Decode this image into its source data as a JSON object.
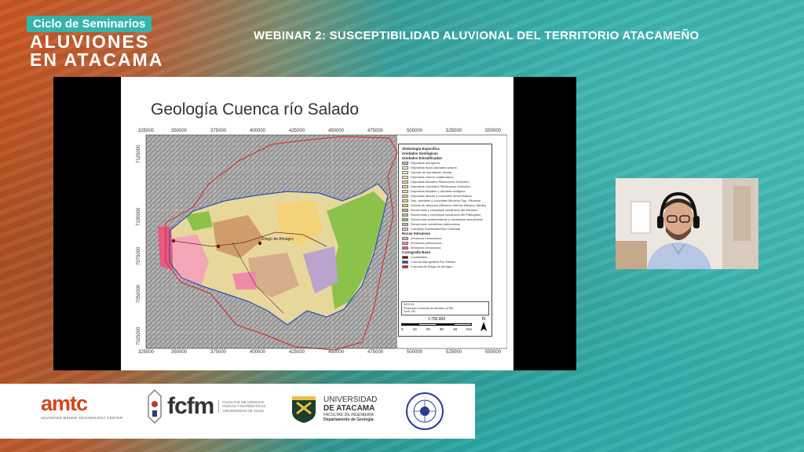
{
  "header": {
    "series_tag": "Ciclo de Seminarios",
    "event_title_line1": "ALUVIONES",
    "event_title_line2": "EN ATACAMA",
    "webinar_title": "WEBINAR 2: SUSCEPTIBILIDAD ALUVIONAL DEL TERRITORIO ATACAMEÑO"
  },
  "slide": {
    "title": "Geología Cuenca río Salado",
    "x_ticks": [
      "325000",
      "350000",
      "375000",
      "400000",
      "425000",
      "450000",
      "475000",
      "500000",
      "525000",
      "550000"
    ],
    "y_ticks": [
      "7125000",
      "7100000",
      "7075000",
      "7050000",
      "7025000"
    ],
    "map_labels": {
      "town": "Diego de Almagro"
    },
    "legend": {
      "title": "Simbología Específica",
      "section_units": "Unidades Geológicas",
      "section_strat": "Unidades Estratificadas",
      "items": [
        {
          "label": "Depósitos antrópicos",
          "color": "#b8b8b8"
        },
        {
          "label": "Depósitos fluvio-aluviales activos",
          "color": "#f4f0b8"
        },
        {
          "label": "Llanura de inundación aluvial",
          "color": "#fff59a"
        },
        {
          "label": "Depósitos eólicos cuaternarios",
          "color": "#f7e7a1"
        },
        {
          "label": "Depósitos aluviales Pleistoceno-Holoceno",
          "color": "#f4d27a"
        },
        {
          "label": "Depósitos coluviales Pleistoceno-Holoceno",
          "color": "#e8c99a"
        },
        {
          "label": "Depósitos fluviales y aluviales antiguos",
          "color": "#e6d6b0"
        },
        {
          "label": "Depósitos lávicos y coluviales derrumbados",
          "color": "#d9c7a0"
        },
        {
          "label": "Dep. aluviales y coluviales Mioceno Sup.-Plioceno",
          "color": "#e3cf7c"
        },
        {
          "label": "Gravas de Atacama (Mioceno Inferior-Mioceno Medio)",
          "color": "#e9b45d"
        },
        {
          "label": "Secuencias y complejos volcánicos del Mioceno",
          "color": "#cf9d6b"
        },
        {
          "label": "Secuencias y complejos volcánicos del Paleógeno",
          "color": "#d7ae8c"
        },
        {
          "label": "Secuencias sedimentarias y volcánicas mesozoicas",
          "color": "#8bc34a"
        },
        {
          "label": "Secuencias volcánicas paleozoicas",
          "color": "#b9a3cf"
        },
        {
          "label": "Complejo Epimetamórfico Chañaral",
          "color": "#d8c8e8"
        }
      ],
      "section_intrusive": "Rocas Intrusivas",
      "intrusive_items": [
        {
          "label": "Intrusivos mesozoicos",
          "color": "#f4a6b7"
        },
        {
          "label": "Intrusivos paleozoicos",
          "color": "#f08aa8"
        },
        {
          "label": "Intrusivos cenozoicos",
          "color": "#e95a80"
        }
      ],
      "section_base": "Cartografía Base",
      "base_items": [
        {
          "label": "Localidades",
          "color": "#7a1010"
        },
        {
          "label": "Cuenca hidrográfica Río Salado",
          "color": "#2a4fbf"
        },
        {
          "label": "Comuna de Diego de Almagro",
          "color": "#d22"
        }
      ],
      "info_lines": [
        "WGS 84",
        "Proyección Universal de Mercator (UTM)",
        "Zona 19S"
      ],
      "scale_text": "1:750.000",
      "scale_labels": [
        "0",
        "10",
        "20",
        "30",
        "40"
      ],
      "scale_unit": "Km",
      "north": "N"
    }
  },
  "footer": {
    "amtc": {
      "name": "amtc",
      "sub": "ADVANCED MINING TECHNOLOGY CENTER"
    },
    "fcfm": {
      "name": "fcfm",
      "sub1": "FACULTAD DE CIENCIAS",
      "sub2": "FÍSICAS Y MATEMÁTICAS",
      "sub3": "UNIVERSIDAD DE CHILE"
    },
    "uda": {
      "line1": "UNIVERSIDAD",
      "line2": "DE ATACAMA",
      "sub1": "FACULTAD DE INGENIERÍA",
      "sub2": "Departamento de Geología"
    },
    "sgch": {
      "ring_text": "SOCIEDAD GEOLÓGICA DE CHILE"
    }
  },
  "colors": {
    "accent_teal": "#35b3ad",
    "accent_orange": "#d2461e",
    "basin_outline": "#2a4fbf",
    "commune_outline": "#d22"
  }
}
